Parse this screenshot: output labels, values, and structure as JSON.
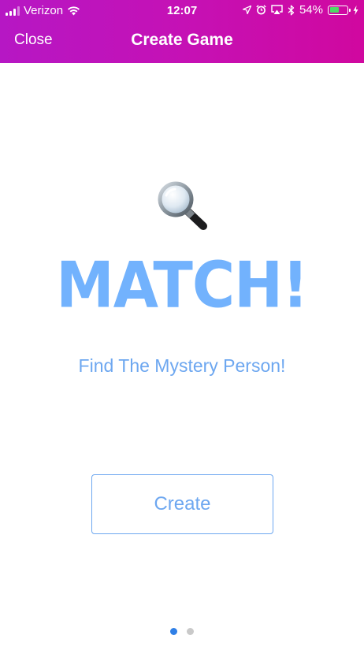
{
  "status_bar": {
    "carrier": "Verizon",
    "time": "12:07",
    "battery_percent": "54%",
    "battery_level": 0.54,
    "signal_bars_active": 3,
    "signal_bars_total": 4,
    "icons": [
      "wifi-icon",
      "location-icon",
      "alarm-icon",
      "screen-mirroring-icon",
      "bluetooth-icon",
      "charging-bolt-icon"
    ]
  },
  "nav": {
    "close_label": "Close",
    "title": "Create Game"
  },
  "main": {
    "icon": "magnifying-glass-icon",
    "title": "MATCH!",
    "subtitle": "Find The Mystery Person!",
    "create_label": "Create"
  },
  "pagination": {
    "current_page": 1,
    "total_pages": 2
  },
  "colors": {
    "header_gradient_start": "#b617c4",
    "header_gradient_end": "#d0089f",
    "accent_blue": "#6da7f0",
    "title_blue": "#72b2fd",
    "dot_active": "#2f7fe6",
    "dot_inactive": "#c9c9c9",
    "battery_green": "#4cd964"
  }
}
